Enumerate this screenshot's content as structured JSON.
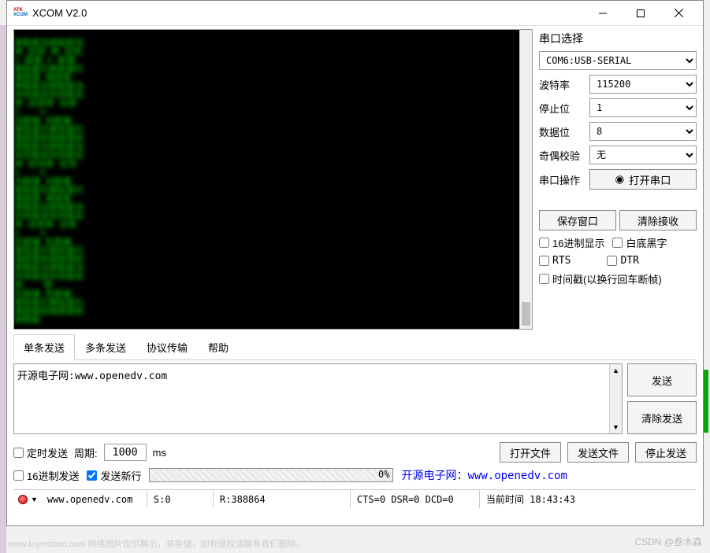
{
  "titlebar": {
    "title": "XCOM V2.0"
  },
  "sidepanel": {
    "port_section_label": "串口选择",
    "port_value": "COM6:USB-SERIAL",
    "baud_label": "波特率",
    "baud_value": "115200",
    "stopbit_label": "停止位",
    "stopbit_value": "1",
    "databit_label": "数据位",
    "databit_value": "8",
    "parity_label": "奇偶校验",
    "parity_value": "无",
    "port_op_label": "串口操作",
    "open_port_btn": "打开串口",
    "save_window_btn": "保存窗口",
    "clear_recv_btn": "清除接收",
    "hex_display_chk": "16进制显示",
    "white_bg_chk": "白底黑字",
    "rts_chk": "RTS",
    "dtr_chk": "DTR",
    "timestamp_chk": "时间戳(以换行回车断帧)"
  },
  "tabs": {
    "single": "单条发送",
    "multi": "多条发送",
    "protocol": "协议传输",
    "help": "帮助"
  },
  "send": {
    "text": "开源电子网:www.openedv.com",
    "send_btn": "发送",
    "clear_send_btn": "清除发送"
  },
  "options": {
    "timed_send_chk": "定时发送",
    "period_label": "周期:",
    "period_value": "1000",
    "period_unit": "ms",
    "open_file_btn": "打开文件",
    "send_file_btn": "发送文件",
    "stop_send_btn": "停止发送",
    "hex_send_chk": "16进制发送",
    "send_newline_chk": "发送新行",
    "progress_text": "0%",
    "link_text": "开源电子网：www.openedv.com"
  },
  "statusbar": {
    "url": "www.openedv.com",
    "s": "S:0",
    "r": "R:388864",
    "signals": "CTS=0 DSR=0 DCD=0",
    "time_label": "当前时间 18:43:43"
  },
  "watermark": "CSDN @叁木森",
  "watermark2": "www.toymoban.com 网络图片仅供展示，非存储，如有侵权请联系我们删除。"
}
